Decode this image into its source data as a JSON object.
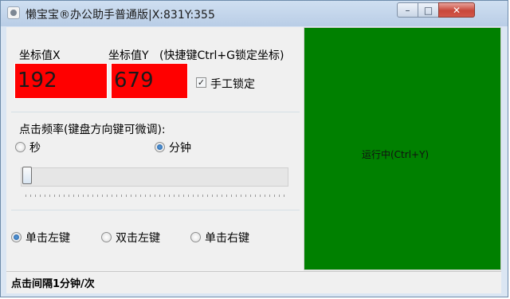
{
  "window": {
    "title": "懒宝宝®办公助手普通版|X:831Y:355",
    "minimize_label": "–",
    "maximize_label": "□",
    "close_label": "✕"
  },
  "coords": {
    "x_label": "坐标值X",
    "y_label": "坐标值Y",
    "hint": "(快捷键Ctrl+G锁定坐标)",
    "x_value": "192",
    "y_value": "679",
    "box_color": "#ff0000",
    "manual_lock_label": "手工锁定",
    "manual_lock_checked": true
  },
  "frequency": {
    "label": "点击频率(键盘方向键可微调):",
    "unit_options": [
      "秒",
      "分钟"
    ],
    "selected_unit": "分钟",
    "slider_value": 1
  },
  "click_mode": {
    "options": [
      "单击左键",
      "双击左键",
      "单击右键"
    ],
    "selected": "单击左键"
  },
  "run_panel": {
    "label": "运行中(Ctrl+Y)",
    "color": "#008000"
  },
  "status": {
    "text": "点击间隔1分钟/次"
  }
}
